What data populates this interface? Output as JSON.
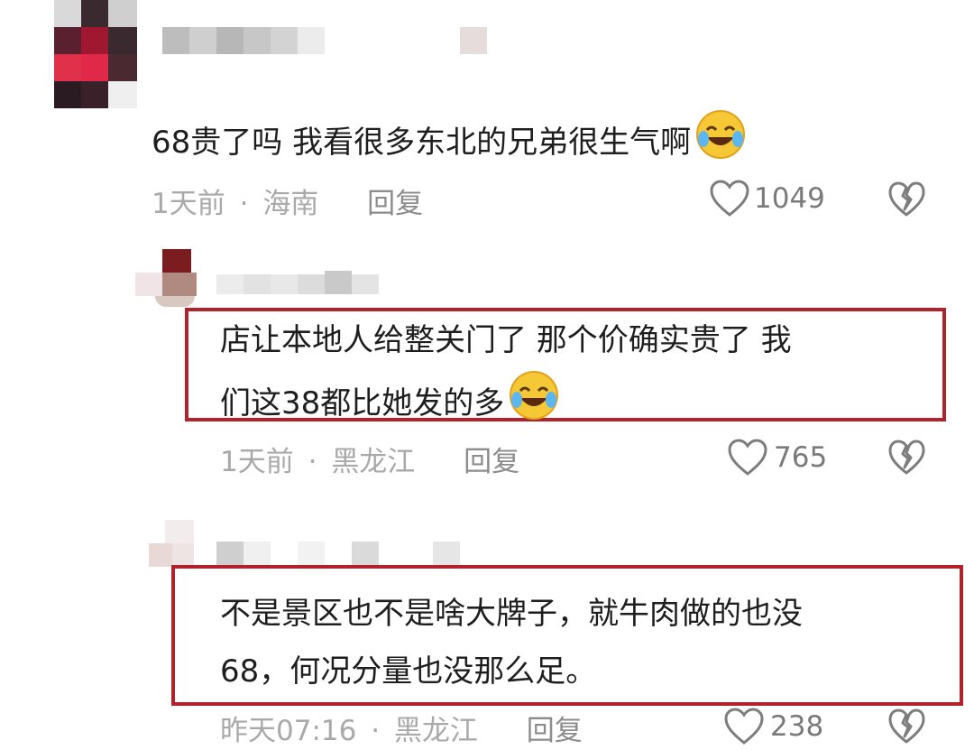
{
  "comments": [
    {
      "text": "68贵了吗   我看很多东北的兄弟很生气啊",
      "emoji": "laughing-crying-emoji",
      "time": "1天前",
      "separator": "·",
      "location": "海南",
      "reply_label": "回复",
      "likes": "1049"
    },
    {
      "line1": "店让本地人给整关门了 那个价确实贵了 我",
      "line2": "们这38都比她发的多",
      "emoji": "laughing-crying-emoji",
      "time": "1天前",
      "separator": "·",
      "location": "黑龙江",
      "reply_label": "回复",
      "likes": "765"
    },
    {
      "line1": "不是景区也不是啥大牌子，就牛肉做的也没",
      "line2": "68，何况分量也没那么足。",
      "time": "昨天07:16",
      "separator": "·",
      "location": "黑龙江",
      "reply_label": "回复",
      "likes": "238"
    }
  ],
  "colors": {
    "highlight_border": "#b0232a",
    "meta_text": "#a9a9a9",
    "body_text": "#1e1e1e"
  },
  "icons": [
    "heart-outline-icon",
    "broken-heart-icon"
  ]
}
